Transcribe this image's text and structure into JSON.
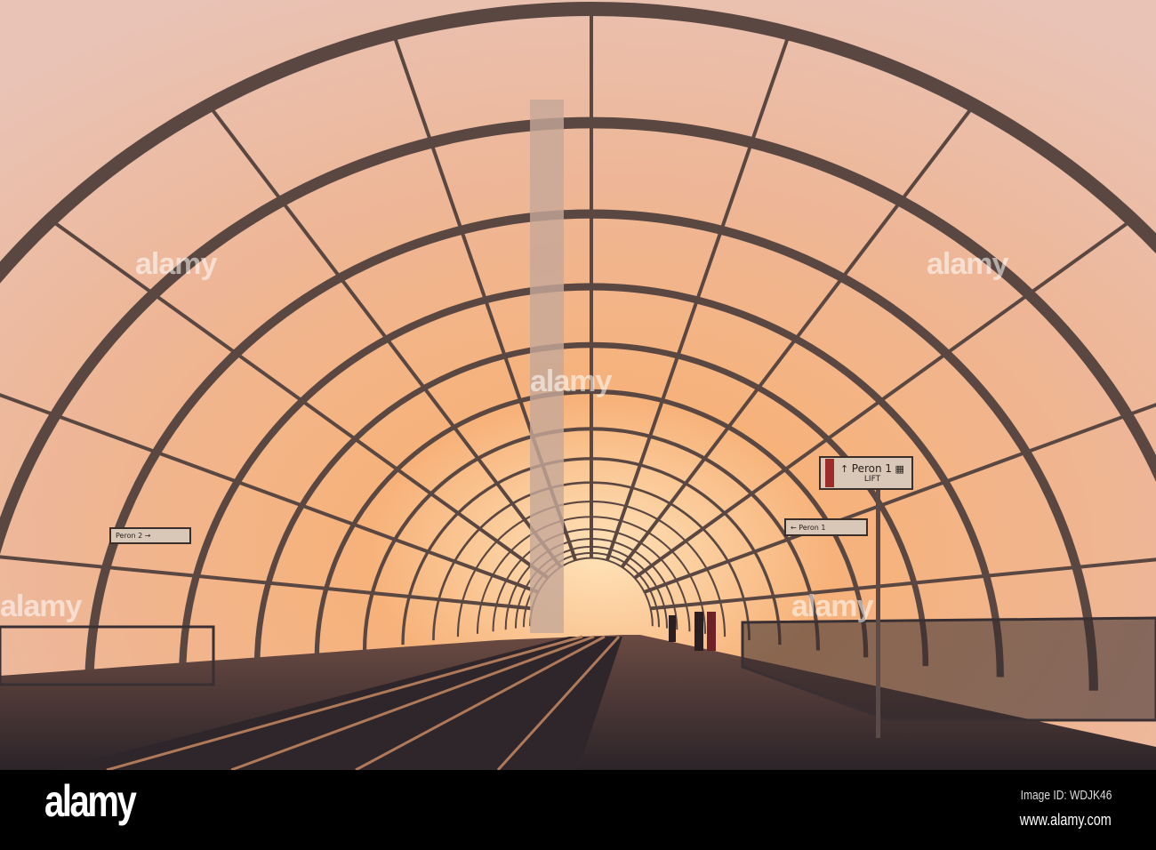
{
  "photo": {
    "subject": "arched glass canopy over train station platform at sunset",
    "signs": {
      "main_sign_label": "Peron 1",
      "main_sign_arrow": "↑",
      "main_sign_sublabel": "LIFT",
      "right_sign_label": "← Peron 1",
      "left_sign_label": "Peron 2 →"
    },
    "watermarks": [
      "alamy",
      "alamy",
      "alamy",
      "alamy",
      "alamy"
    ],
    "colors": {
      "sky_light": "#f6d2b2",
      "sky_warm": "#f0a468",
      "frame": "#5a4742",
      "floor": "#3b3236"
    }
  },
  "footer": {
    "logo": "alamy",
    "image_id": "Image ID: WDJK46",
    "website": "www.alamy.com"
  }
}
